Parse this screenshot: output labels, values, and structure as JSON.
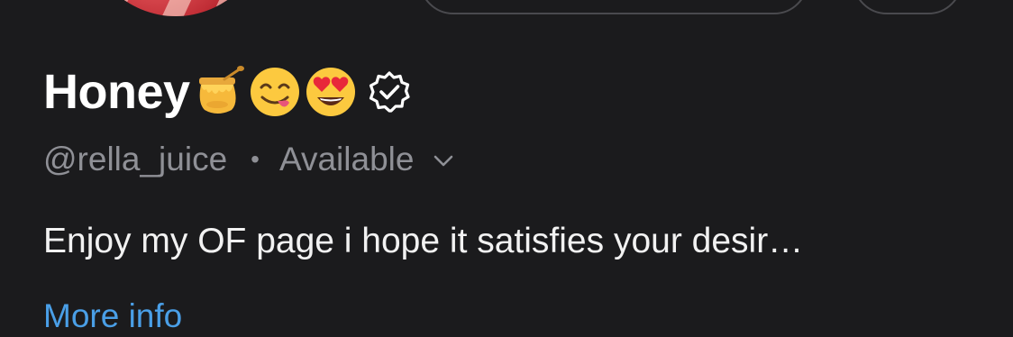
{
  "profile": {
    "display_name": "Honey",
    "name_emojis": [
      "honey-pot-emoji",
      "face-savoring-food-emoji",
      "heart-eyes-emoji"
    ],
    "handle": "@rella_juice",
    "separator": "•",
    "status": "Available",
    "bio": "Enjoy my OF page i hope it satisfies your desir…",
    "more_info_label": "More info"
  },
  "colors": {
    "background": "#1b1b1d",
    "name": "#ffffff",
    "secondary_text": "#8f9096",
    "link": "#4a9fe7"
  }
}
